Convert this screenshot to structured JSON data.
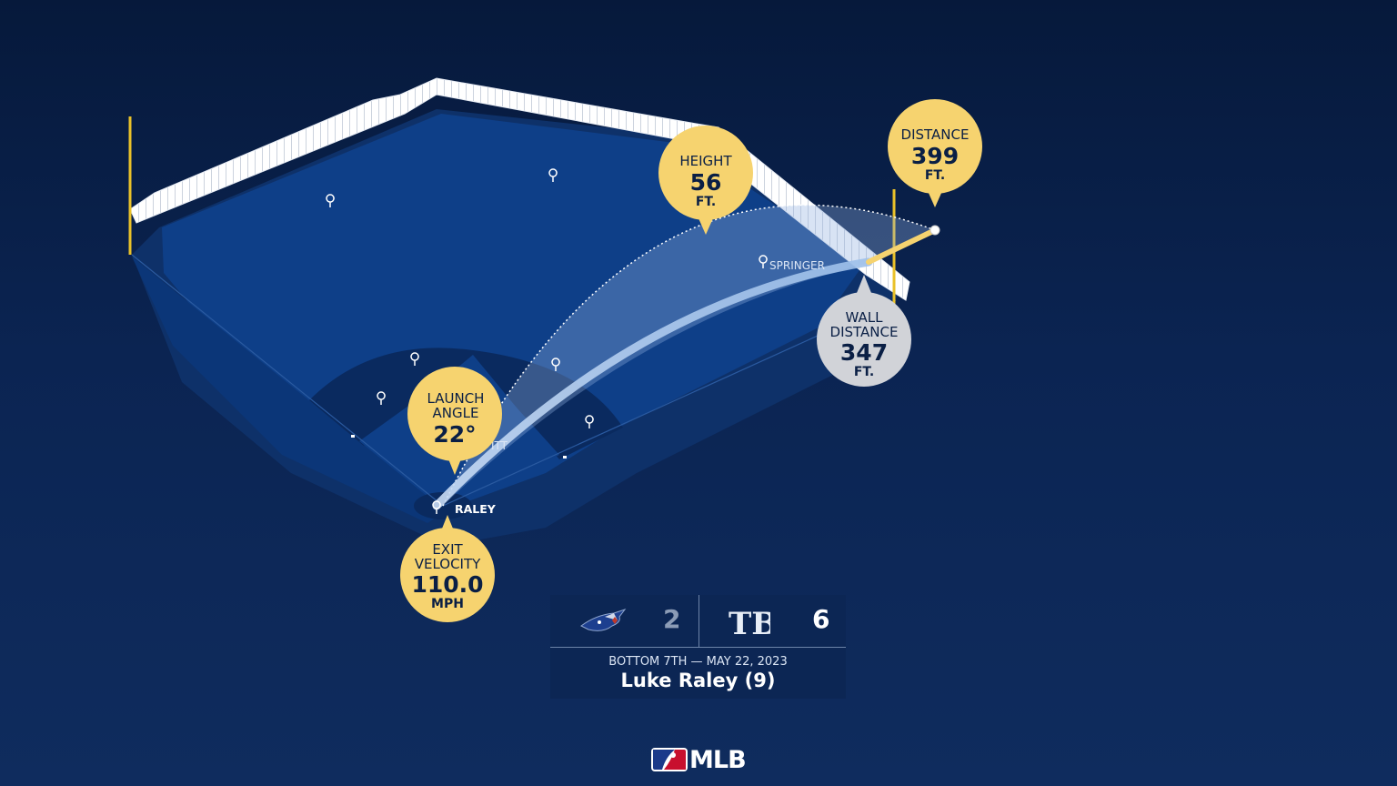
{
  "metrics": {
    "distance": {
      "label": "DISTANCE",
      "value": "399",
      "unit": "FT."
    },
    "height": {
      "label": "HEIGHT",
      "value": "56",
      "unit": "FT."
    },
    "wall_distance": {
      "label_line1": "WALL",
      "label_line2": "DISTANCE",
      "value": "347",
      "unit": "FT."
    },
    "launch_angle": {
      "label_line1": "LAUNCH",
      "label_line2": "ANGLE",
      "value": "22°"
    },
    "exit_velocity": {
      "label_line1": "EXIT",
      "label_line2": "VELOCITY",
      "value": "110.0",
      "unit": "MPH"
    }
  },
  "players": {
    "springer": "SPRINGER",
    "bichette_partial": "ITT",
    "batter": "RALEY"
  },
  "scoreboard": {
    "away_team": "TOR",
    "away_score": "2",
    "home_team_logo_text": "TB",
    "home_score": "6",
    "game_info": "BOTTOM 7TH — MAY 22, 2023",
    "player_title": "Luke Raley (9)"
  },
  "brand": {
    "logo_text": "MLB"
  },
  "colors": {
    "bubble_gold": "#f6d36f",
    "bubble_gray": "#d1d3d8",
    "field_blue": "#0d3d86",
    "infield_dark": "#0a2a5f",
    "foul_pole_yellow": "#e9c12a"
  }
}
